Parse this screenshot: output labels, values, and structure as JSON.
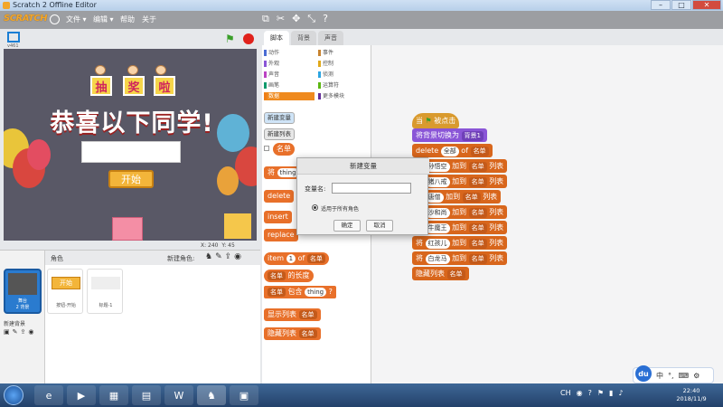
{
  "window": {
    "title": "Scratch 2 Offline Editor"
  },
  "menubar": {
    "logo": "SCRATCH",
    "items": [
      "文件 ▾",
      "编辑 ▾",
      "帮助",
      "关于"
    ]
  },
  "tabs": [
    "脚本",
    "背景",
    "声音"
  ],
  "categories": [
    {
      "label": "动作",
      "color": "#4a6cd4"
    },
    {
      "label": "外观",
      "color": "#8a55d7"
    },
    {
      "label": "声音",
      "color": "#bb42c3"
    },
    {
      "label": "画笔",
      "color": "#0e9a6c"
    },
    {
      "label": "数据",
      "color": "#ee7d16"
    },
    {
      "label": "事件",
      "color": "#c88330"
    },
    {
      "label": "控制",
      "color": "#e1a91a"
    },
    {
      "label": "侦测",
      "color": "#2ca5e2"
    },
    {
      "label": "运算符",
      "color": "#5cb712"
    },
    {
      "label": "更多模块",
      "color": "#632d99"
    }
  ],
  "palette": {
    "new_variable": "新建变量",
    "new_list": "新建列表",
    "list_reporter": "名单",
    "block_add_prefix": "将",
    "block_add_value": "thing",
    "block_delete": "delete",
    "block_insert": "insert",
    "block_replace": "replace",
    "block_item": "item",
    "block_item_num": "1",
    "block_item_of": "of",
    "block_item_list": "名单",
    "block_length_list": "名单",
    "block_length_text": "的长度",
    "block_contains_list": "名单",
    "block_contains_text": "包含",
    "block_contains_value": "thing",
    "block_contains_q": "?",
    "block_show_text": "显示列表",
    "block_show_list": "名单",
    "block_hide_text": "隐藏列表",
    "block_hide_list": "名单"
  },
  "dialog": {
    "title": "新建变量",
    "label": "变量名:",
    "value": "",
    "radio_label": "适用于所有角色",
    "ok": "确定",
    "cancel": "取消"
  },
  "stage": {
    "tag1": "抽",
    "tag2": "奖",
    "tag3": "啦",
    "headline": "恭喜以下同学!",
    "start_button": "开始",
    "coords_x": "X: 240",
    "coords_y": "Y: 45"
  },
  "sprite_pane": {
    "header": "角色",
    "new_sprite": "新建角色:",
    "stage_name": "舞台",
    "stage_sub": "2 背景",
    "new_backdrop": "新建背景",
    "sprites": [
      "按钮-开始",
      "标题-1"
    ],
    "sprite1_label": "开始"
  },
  "script": {
    "hat_when": "当",
    "hat_clicked": "被点击",
    "switch_text": "将背景切换为",
    "switch_value": "背景1",
    "delete_text": "delete",
    "delete_value": "全部",
    "delete_of": "of",
    "delete_list": "名单",
    "add_rows": [
      {
        "name": "孙悟空",
        "list": "名单"
      },
      {
        "name": "猪八戒",
        "list": "名单"
      },
      {
        "name": "唐僧",
        "list": "名单"
      },
      {
        "name": "沙和尚",
        "list": "名单"
      },
      {
        "name": "牛魔王",
        "list": "名单"
      },
      {
        "name": "红孩儿",
        "list": "名单"
      },
      {
        "name": "白龙马",
        "list": "名单"
      }
    ],
    "add_prefix": "将",
    "add_suffix": "加到",
    "list_tail": "列表",
    "hide_text": "隐藏列表",
    "hide_list": "名单"
  },
  "ime": {
    "logo": "du",
    "mode": "中"
  },
  "taskbar": {
    "time": "22:40",
    "date": "2018/11/9",
    "tray_text": "CH"
  }
}
